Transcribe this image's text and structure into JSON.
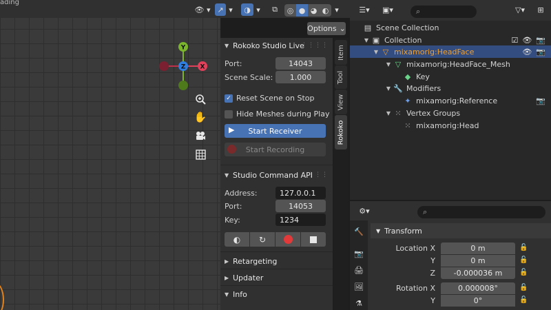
{
  "viewport": {
    "corner_text": "ading",
    "options_label": "Options",
    "gizmo": {
      "y": "Y",
      "z": "Z",
      "x": "X"
    }
  },
  "npanel": {
    "tabs": [
      "Item",
      "Tool",
      "View",
      "Rokoko"
    ],
    "live": {
      "title": "Rokoko Studio Live",
      "port_label": "Port:",
      "port_value": "14043",
      "scale_label": "Scene Scale:",
      "scale_value": "1.000",
      "reset_label": "Reset Scene on Stop",
      "reset_checked": true,
      "hide_label": "Hide Meshes during Play",
      "hide_checked": false,
      "start_receiver": "Start Receiver",
      "start_recording": "Start Recording"
    },
    "command": {
      "title": "Studio Command API",
      "address_label": "Address:",
      "address_value": "127.0.0.1",
      "port_label": "Port:",
      "port_value": "14053",
      "key_label": "Key:",
      "key_value": "1234"
    },
    "collapsed": [
      "Retargeting",
      "Updater",
      "Info"
    ]
  },
  "outliner": {
    "rows": [
      {
        "name": "Scene Collection"
      },
      {
        "name": "Collection"
      },
      {
        "name": "mixamorig:HeadFace"
      },
      {
        "name": "mixamorig:HeadFace_Mesh"
      },
      {
        "name": "Key"
      },
      {
        "name": "Modifiers"
      },
      {
        "name": "mixamorig:Reference"
      },
      {
        "name": "Vertex Groups"
      },
      {
        "name": "mixamorig:Head"
      }
    ]
  },
  "properties": {
    "section": "Transform",
    "rows": [
      {
        "label": "Location X",
        "value": "0 m"
      },
      {
        "label": "Y",
        "value": "0 m"
      },
      {
        "label": "Z",
        "value": "-0.000036 m"
      },
      {
        "label": "Rotation X",
        "value": "0.000008°"
      },
      {
        "label": "Y",
        "value": "0°"
      }
    ]
  },
  "colors": {
    "accent": "#4772b3",
    "selected_row": "#334d80",
    "active_object": "#f0a030",
    "axis_x": "#e0405a",
    "axis_y": "#7ab52c",
    "axis_z": "#2f7fe0"
  }
}
